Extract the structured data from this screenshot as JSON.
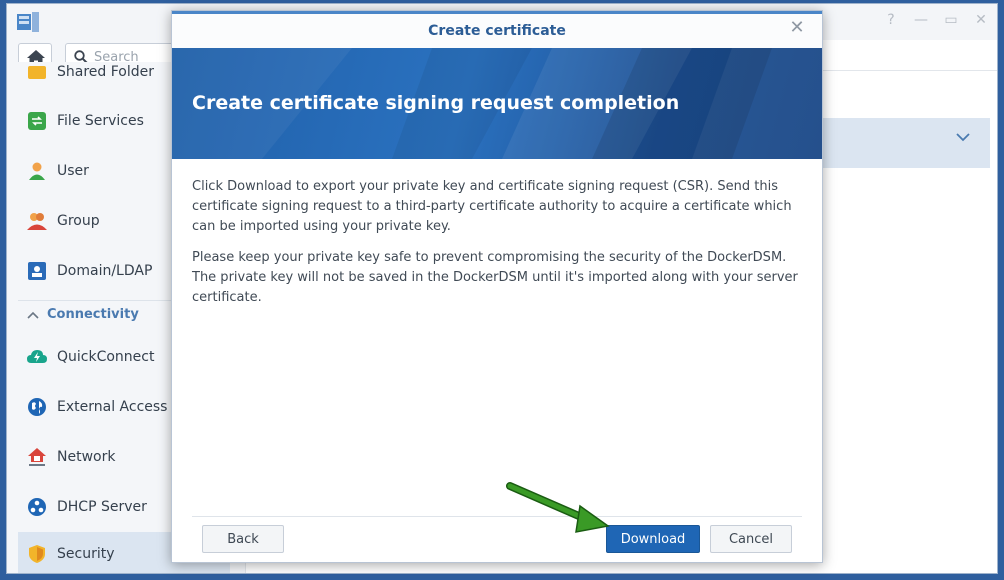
{
  "app": {
    "search_placeholder": "Search",
    "window_controls": [
      "help-icon",
      "minimize-icon",
      "maximize-icon",
      "close-icon"
    ]
  },
  "sidebar": {
    "partial_item": "Shared Folder",
    "items": [
      {
        "label": "File Services",
        "icon": "file-services-icon"
      },
      {
        "label": "User",
        "icon": "user-icon"
      },
      {
        "label": "Group",
        "icon": "group-icon"
      },
      {
        "label": "Domain/LDAP",
        "icon": "domain-ldap-icon"
      }
    ],
    "section": "Connectivity",
    "connectivity_items": [
      {
        "label": "QuickConnect",
        "icon": "quickconnect-icon"
      },
      {
        "label": "External Access",
        "icon": "globe-icon"
      },
      {
        "label": "Network",
        "icon": "network-house-icon"
      },
      {
        "label": "DHCP Server",
        "icon": "dhcp-server-icon"
      },
      {
        "label": "Security",
        "icon": "shield-icon",
        "active": true
      }
    ]
  },
  "modal": {
    "title": "Create certificate",
    "banner_title": "Create certificate signing request completion",
    "paragraph1": "Click Download to export your private key and certificate signing request (CSR). Send this certificate signing request to a third-party certificate authority to acquire a certificate which can be imported using your private key.",
    "paragraph2": "Please keep your private key safe to prevent compromising the security of the DockerDSM. The private key will not be saved in the DockerDSM until it's imported along with your server certificate.",
    "buttons": {
      "back": "Back",
      "download": "Download",
      "cancel": "Cancel"
    }
  },
  "colors": {
    "accent": "#1f66b5",
    "banner": "#2b72c0",
    "title_text": "#2c5d96",
    "annotation_arrow": "#2e8b1f"
  }
}
